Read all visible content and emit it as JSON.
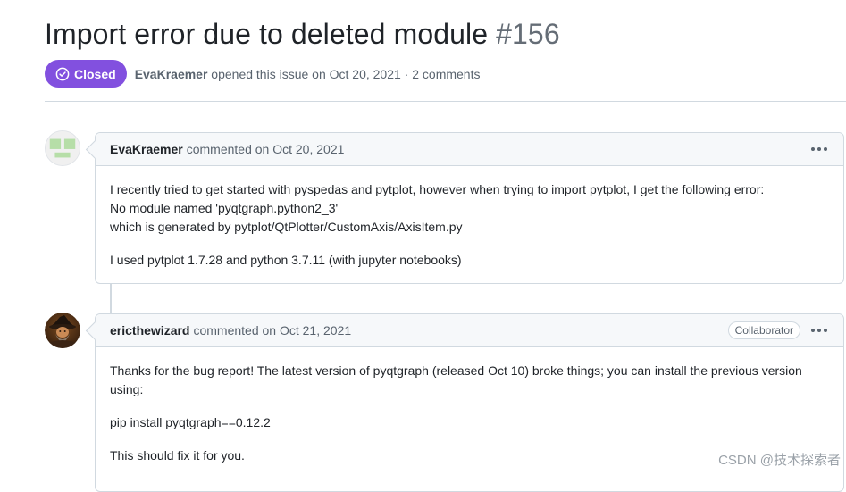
{
  "issue": {
    "title": "Import error due to deleted module",
    "number": "#156",
    "state_label": "Closed",
    "author": "EvaKraemer",
    "meta_text": " opened this issue on Oct 20, 2021 · 2 comments"
  },
  "comments": [
    {
      "author": "EvaKraemer",
      "meta": "commented on Oct 20, 2021",
      "body_lines": [
        "I recently tried to get started with pyspedas and pytplot, however when trying to import pytplot, I get the following error:",
        "No module named 'pyqtgraph.python2_3'",
        "which is generated by pytplot/QtPlotter/CustomAxis/AxisItem.py"
      ],
      "body_p2": "I used pytplot 1.7.28 and python 3.7.11 (with jupyter notebooks)"
    },
    {
      "author": "ericthewizard",
      "meta": "commented on Oct 21, 2021",
      "role": "Collaborator",
      "body_p1": "Thanks for the bug report! The latest version of pyqtgraph (released Oct 10) broke things; you can install the previous version using:",
      "body_p2": "pip install pyqtgraph==0.12.2",
      "body_p3": "This should fix it for you."
    }
  ],
  "watermark": "CSDN @技术探索者",
  "colors": {
    "closed_badge": "#8250df",
    "border": "#d1d9e0",
    "header_bg": "#f6f8fa",
    "muted_text": "#59636e"
  },
  "icons": {
    "state": "check-circle-icon",
    "comment_menu": "kebab-horizontal-icon"
  }
}
